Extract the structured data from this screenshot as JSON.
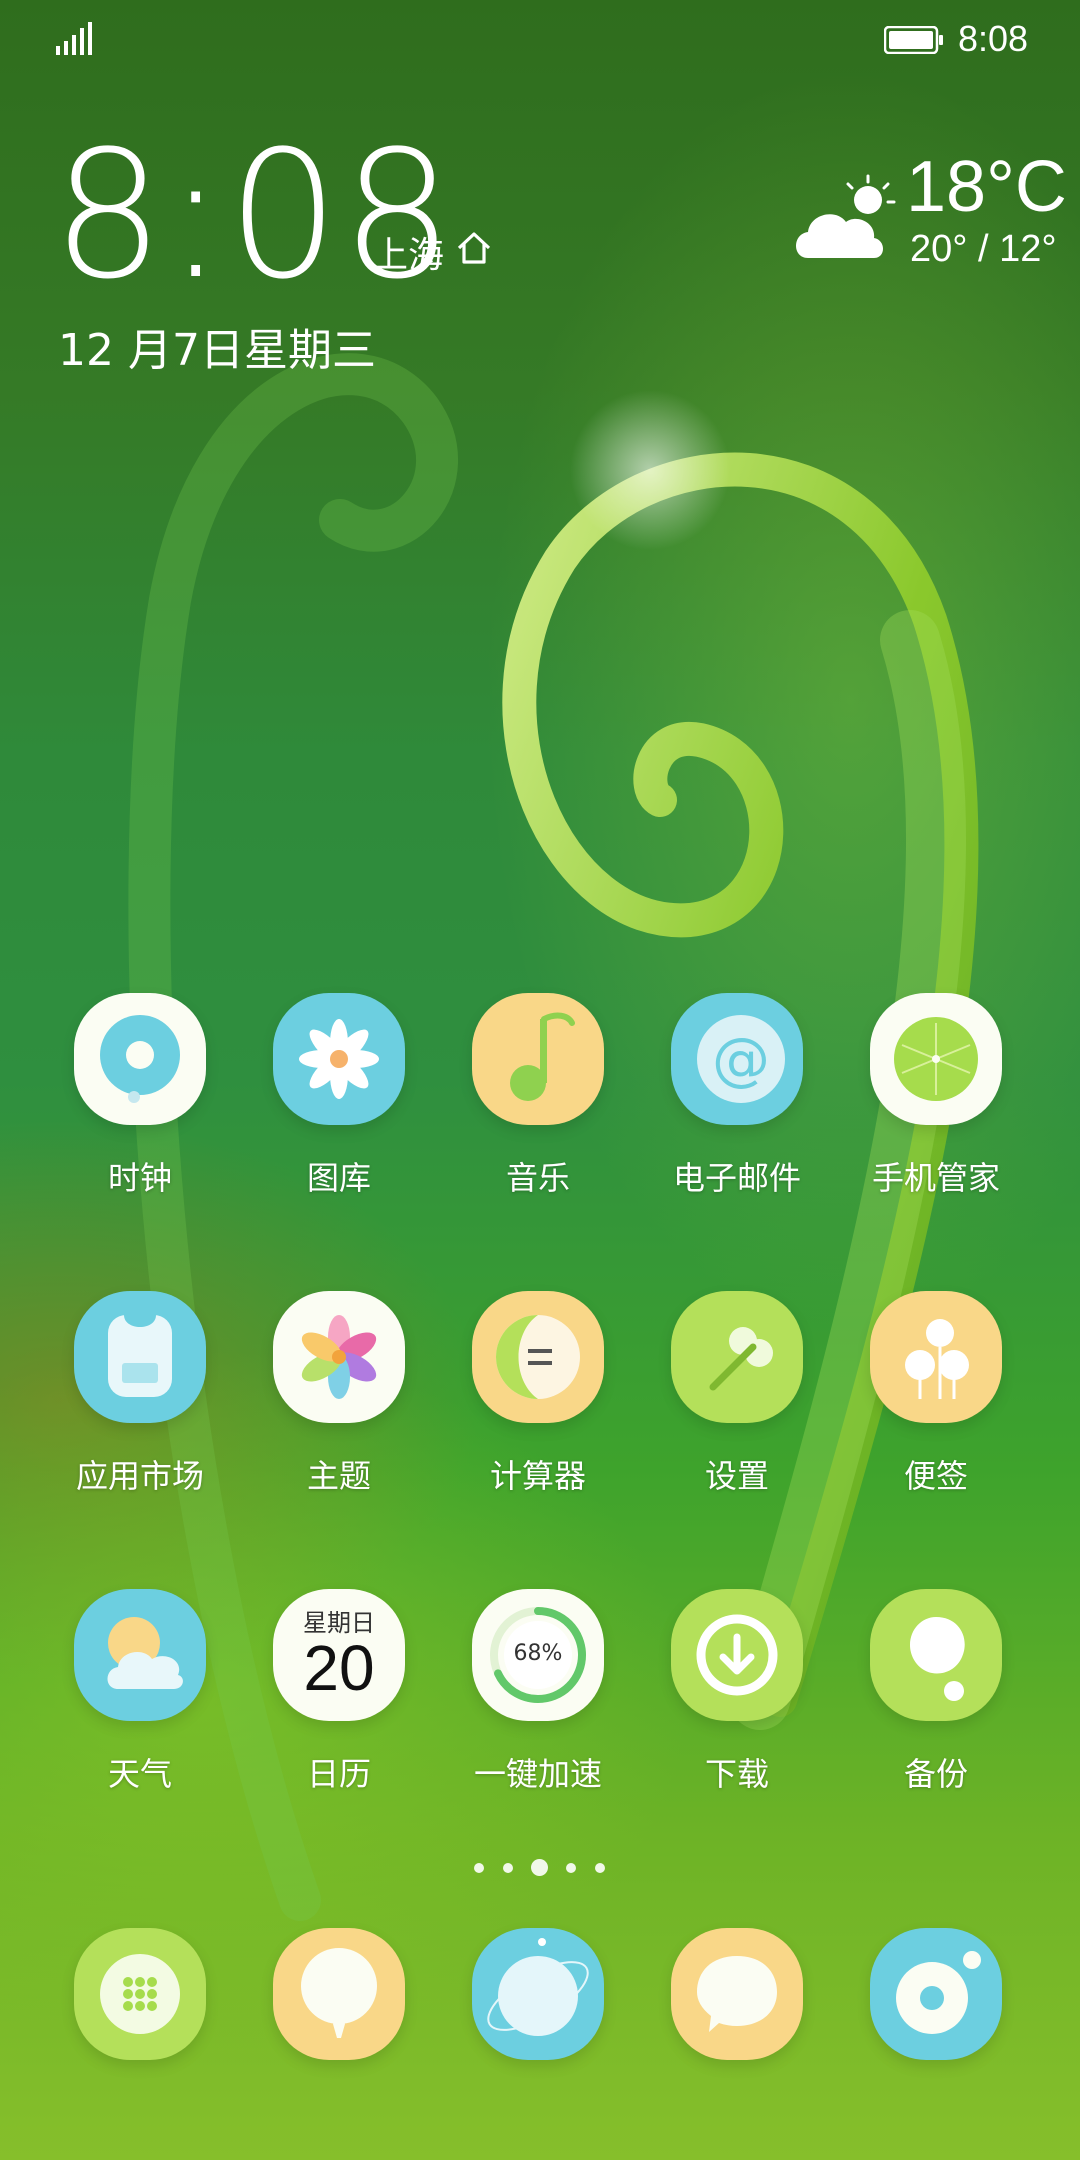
{
  "status_bar": {
    "time": "8:08",
    "signal_icon": "signal-bars-icon",
    "battery_icon": "battery-full-icon"
  },
  "clock_widget": {
    "time": "8:08",
    "city": "上海",
    "date": "12 月7日星期三"
  },
  "weather_widget": {
    "icon": "partly-cloudy-icon",
    "temperature": "18°C",
    "range": "20° / 12°"
  },
  "apps": [
    {
      "label": "时钟",
      "icon": "clock-icon",
      "color": "#fbfdf3"
    },
    {
      "label": "图库",
      "icon": "gallery-icon",
      "color": "#6ccfe0"
    },
    {
      "label": "音乐",
      "icon": "music-icon",
      "color": "#f9d788"
    },
    {
      "label": "电子邮件",
      "icon": "email-icon",
      "color": "#6ccfe0"
    },
    {
      "label": "手机管家",
      "icon": "phone-manager-icon",
      "color": "#fbfdf3"
    },
    {
      "label": "应用市场",
      "icon": "app-market-icon",
      "color": "#6ccfe0"
    },
    {
      "label": "主题",
      "icon": "theme-icon",
      "color": "#fbfdf3"
    },
    {
      "label": "计算器",
      "icon": "calculator-icon",
      "color": "#f9d788"
    },
    {
      "label": "设置",
      "icon": "settings-icon",
      "color": "#b4e05a"
    },
    {
      "label": "便签",
      "icon": "notes-icon",
      "color": "#f9d788"
    },
    {
      "label": "天气",
      "icon": "weather-icon",
      "color": "#6ccfe0"
    },
    {
      "label": "日历",
      "icon": "calendar-icon",
      "color": "#fbfdf3",
      "weekday": "星期日",
      "day": "20"
    },
    {
      "label": "一键加速",
      "icon": "boost-icon",
      "color": "#fbfdf3",
      "percent": "68%"
    },
    {
      "label": "下载",
      "icon": "download-icon",
      "color": "#b4e05a"
    },
    {
      "label": "备份",
      "icon": "backup-icon",
      "color": "#b4e05a"
    }
  ],
  "page_indicator": {
    "count": 5,
    "active": 3
  },
  "dock": [
    {
      "icon": "phone-dialer-icon",
      "color": "#b4e05a"
    },
    {
      "icon": "contacts-icon",
      "color": "#f9d788"
    },
    {
      "icon": "browser-icon",
      "color": "#6ccfe0"
    },
    {
      "icon": "messages-icon",
      "color": "#f9d788"
    },
    {
      "icon": "camera-icon",
      "color": "#6ccfe0"
    }
  ]
}
